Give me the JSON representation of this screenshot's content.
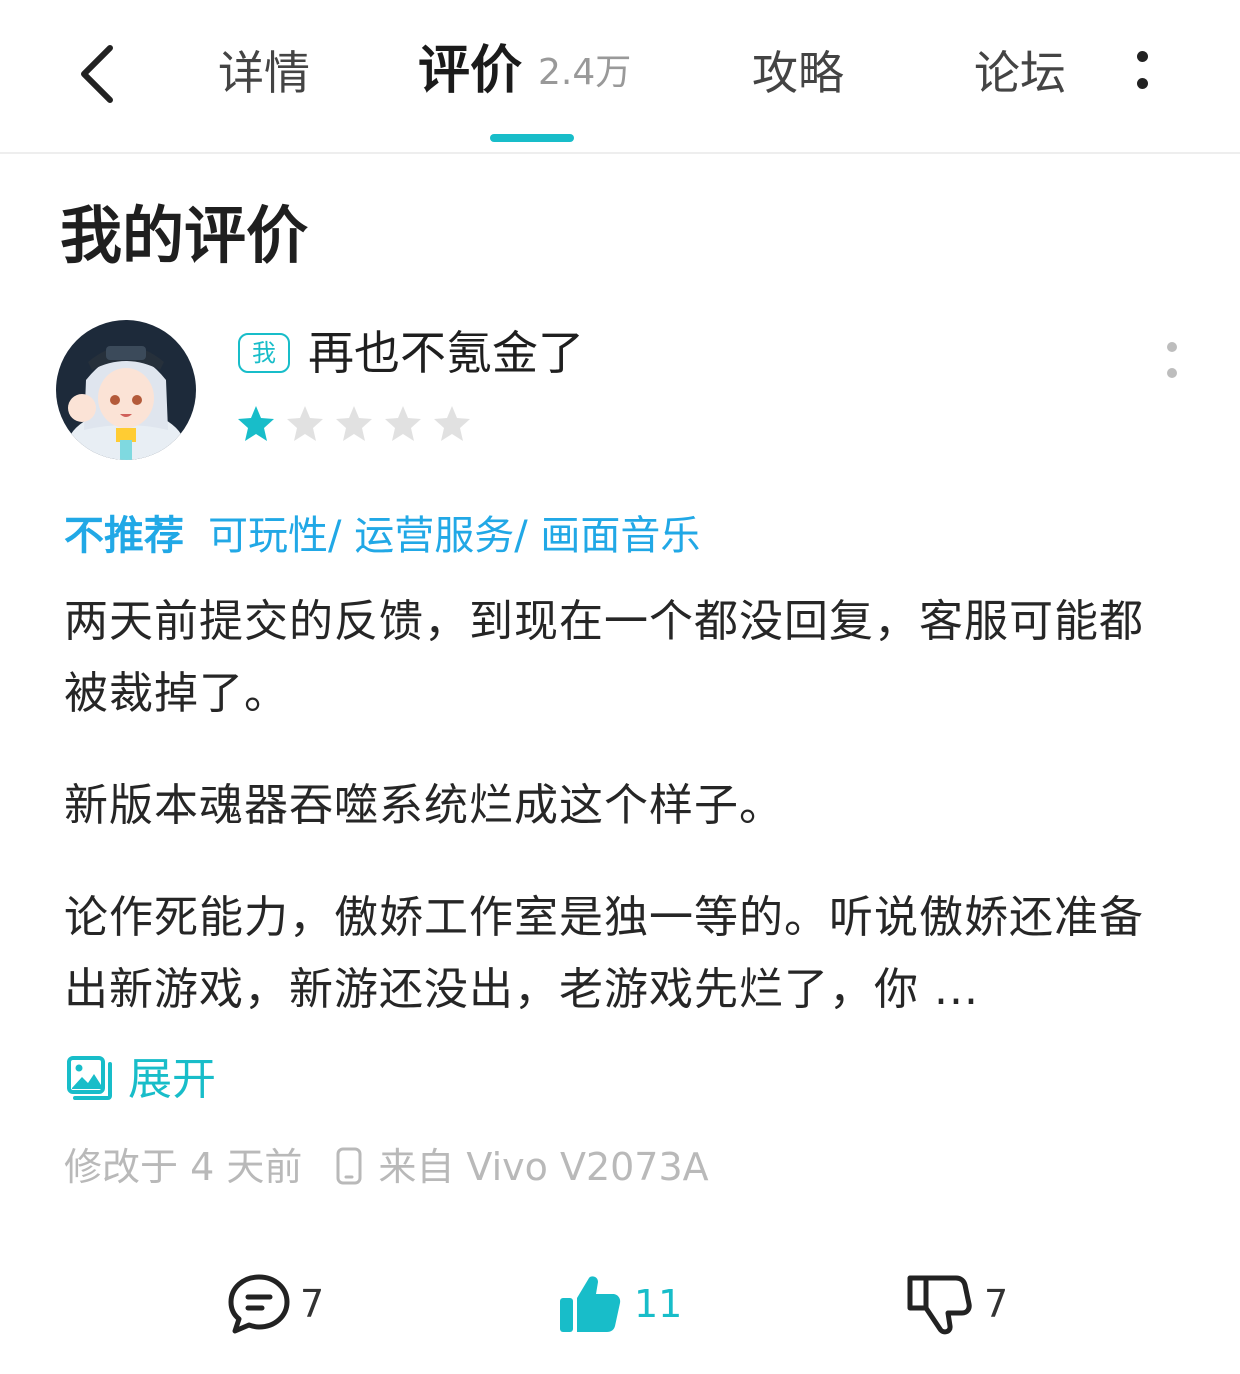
{
  "nav": {
    "tabs": [
      {
        "label": "详情"
      },
      {
        "label": "评价",
        "count": "2.4万"
      },
      {
        "label": "攻略"
      },
      {
        "label": "论坛"
      }
    ],
    "active_tab": 1
  },
  "section_title": "我的评价",
  "review": {
    "me_badge": "我",
    "username": "再也不氪金了",
    "rating": 1,
    "rating_max": 5,
    "recommend_tag": "不推荐",
    "aspects": "可玩性/ 运营服务/ 画面音乐",
    "paragraphs": [
      "两天前提交的反馈，到现在一个都没回复，客服可能都被裁掉了。",
      "新版本魂器吞噬系统烂成这个样子。",
      "论作死能力，傲娇工作室是独一等的。听说傲娇还准备出新游戏，新游还没出，老游戏先烂了，你 ..."
    ],
    "expand_label": "展开",
    "modified": "修改于 4 天前",
    "device": "来自 Vivo V2073A"
  },
  "actions": {
    "comments": "7",
    "likes": "11",
    "dislikes": "7"
  },
  "colors": {
    "accent": "#18bdc9",
    "tag_blue": "#21a8e6",
    "meta_gray": "#b9b9b9"
  }
}
